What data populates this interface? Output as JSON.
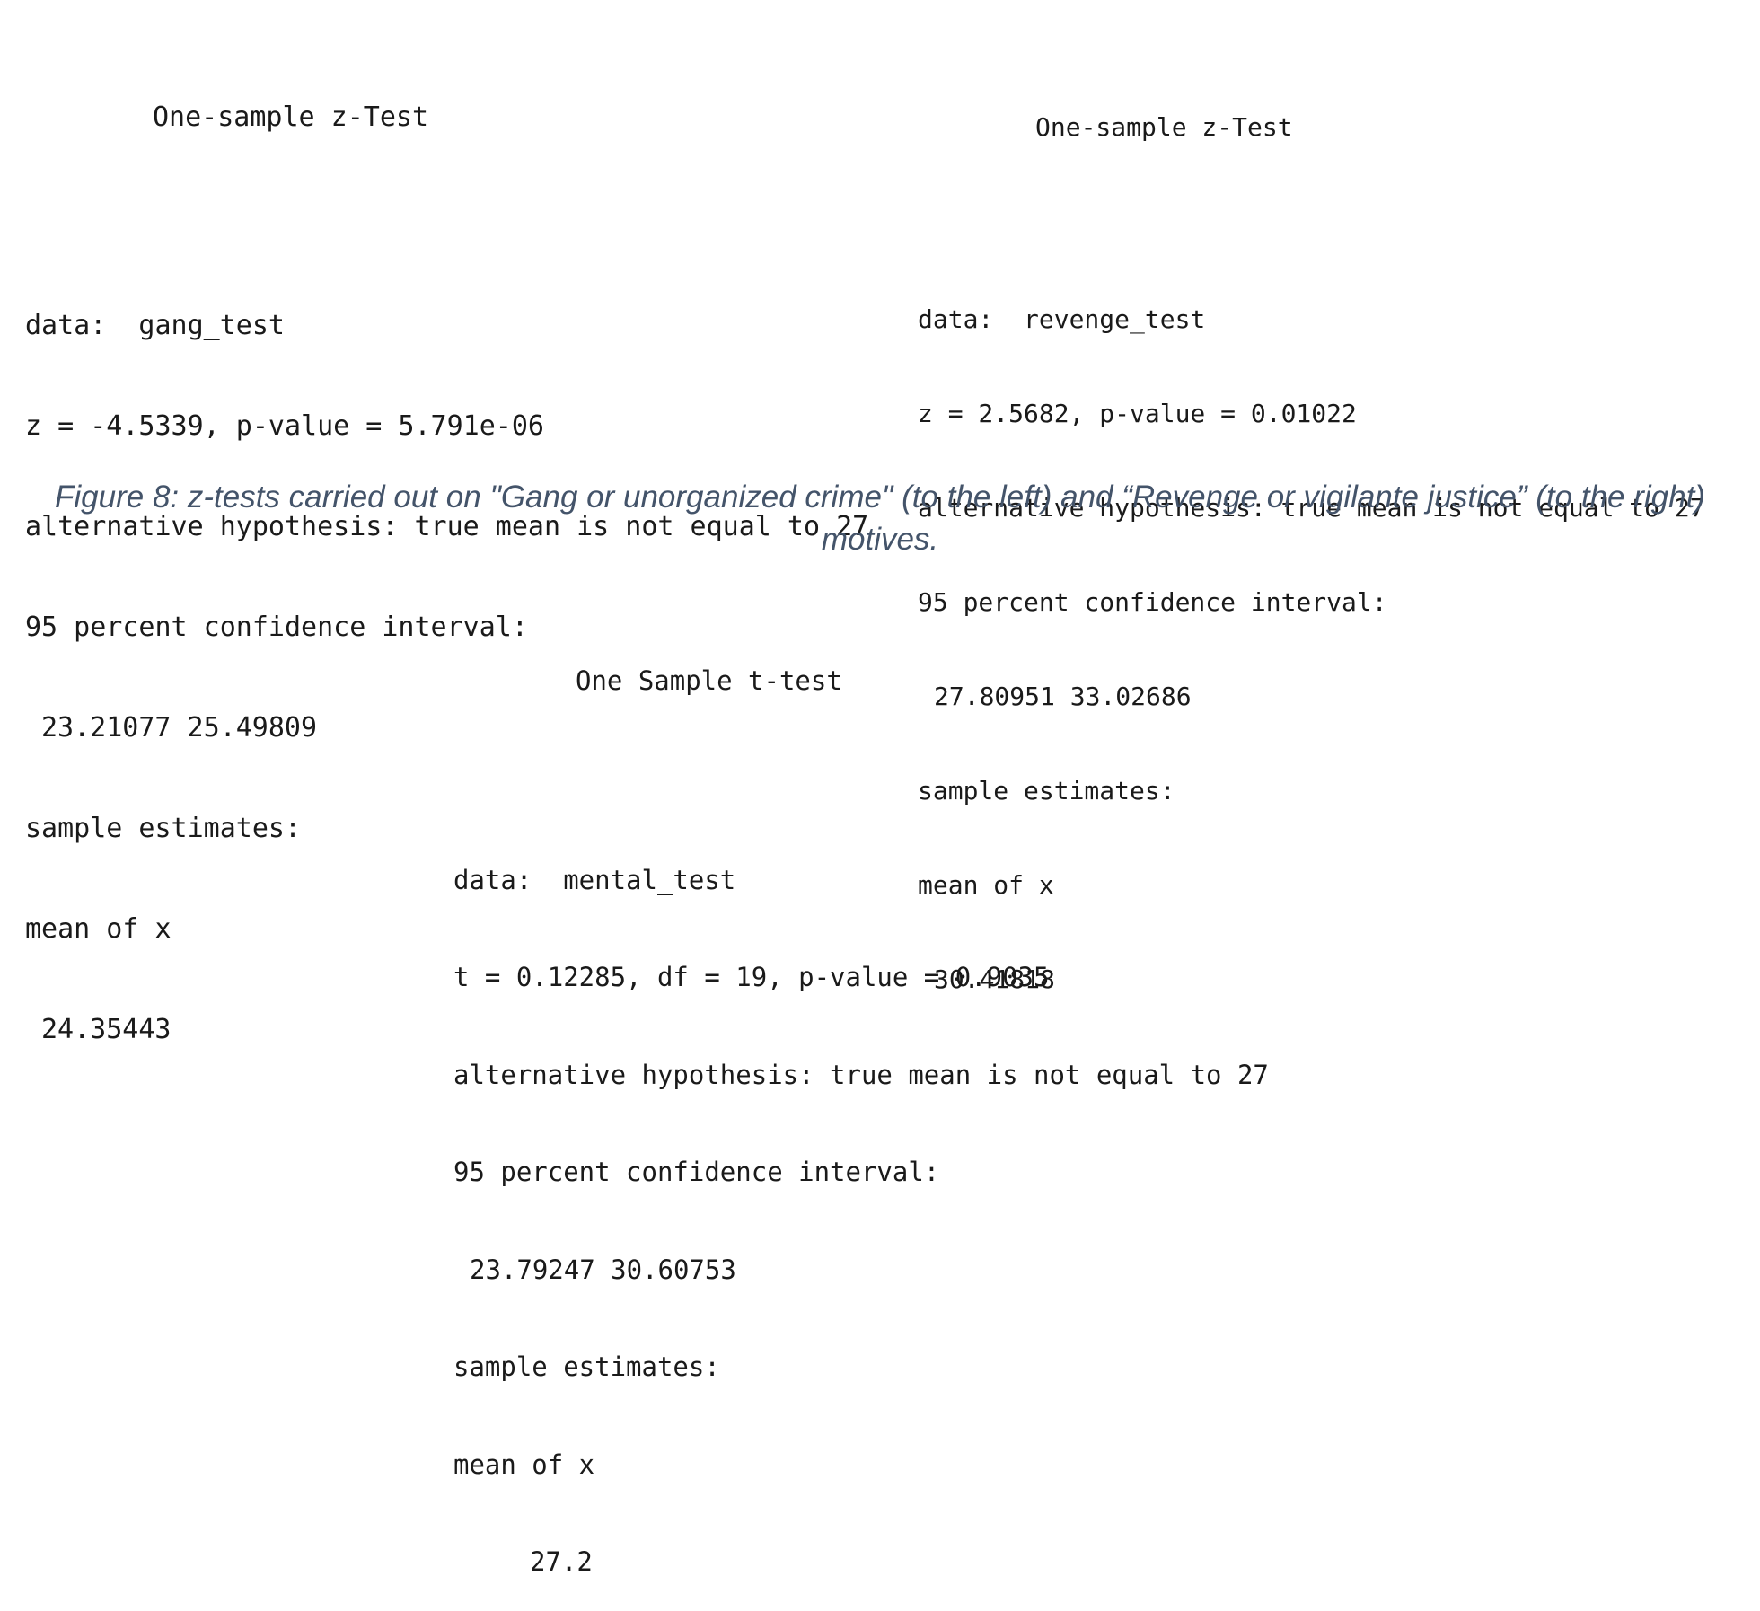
{
  "left_output": {
    "title": "One-sample z-Test",
    "data_line": "data:  gang_test",
    "stat_line": "z = -4.5339, p-value = 5.791e-06",
    "alt_hypothesis": "alternative hypothesis: true mean is not equal to 27",
    "ci_label": "95 percent confidence interval:",
    "ci_values": "23.21077 25.49809",
    "estimates_label": "sample estimates:",
    "mean_label": "mean of x",
    "mean_value": "24.35443"
  },
  "right_output": {
    "title": "One-sample z-Test",
    "data_line": "data:  revenge_test",
    "stat_line": "z = 2.5682, p-value = 0.01022",
    "alt_hypothesis": "alternative hypothesis: true mean is not equal to 27",
    "ci_label": "95 percent confidence interval:",
    "ci_values": "27.80951 33.02686",
    "estimates_label": "sample estimates:",
    "mean_label": "mean of x",
    "mean_value": "30.41818"
  },
  "caption": {
    "line1": "Figure 8: z-tests carried out on \"Gang or unorganized crime\" (to the left) and “Revenge or vigilante justice” (to the right)",
    "line2": "motives."
  },
  "bottom_output": {
    "title": "One Sample t-test",
    "data_line": "data:  mental_test",
    "stat_line": "t = 0.12285, df = 19, p-value = 0.9035",
    "alt_hypothesis": "alternative hypothesis: true mean is not equal to 27",
    "ci_label": "95 percent confidence interval:",
    "ci_values": "23.79247 30.60753",
    "estimates_label": "sample estimates:",
    "mean_label": "mean of x",
    "mean_value": "27.2"
  },
  "colors": {
    "text": "#1a1a1a",
    "caption": "#44546a",
    "background": "#ffffff"
  }
}
